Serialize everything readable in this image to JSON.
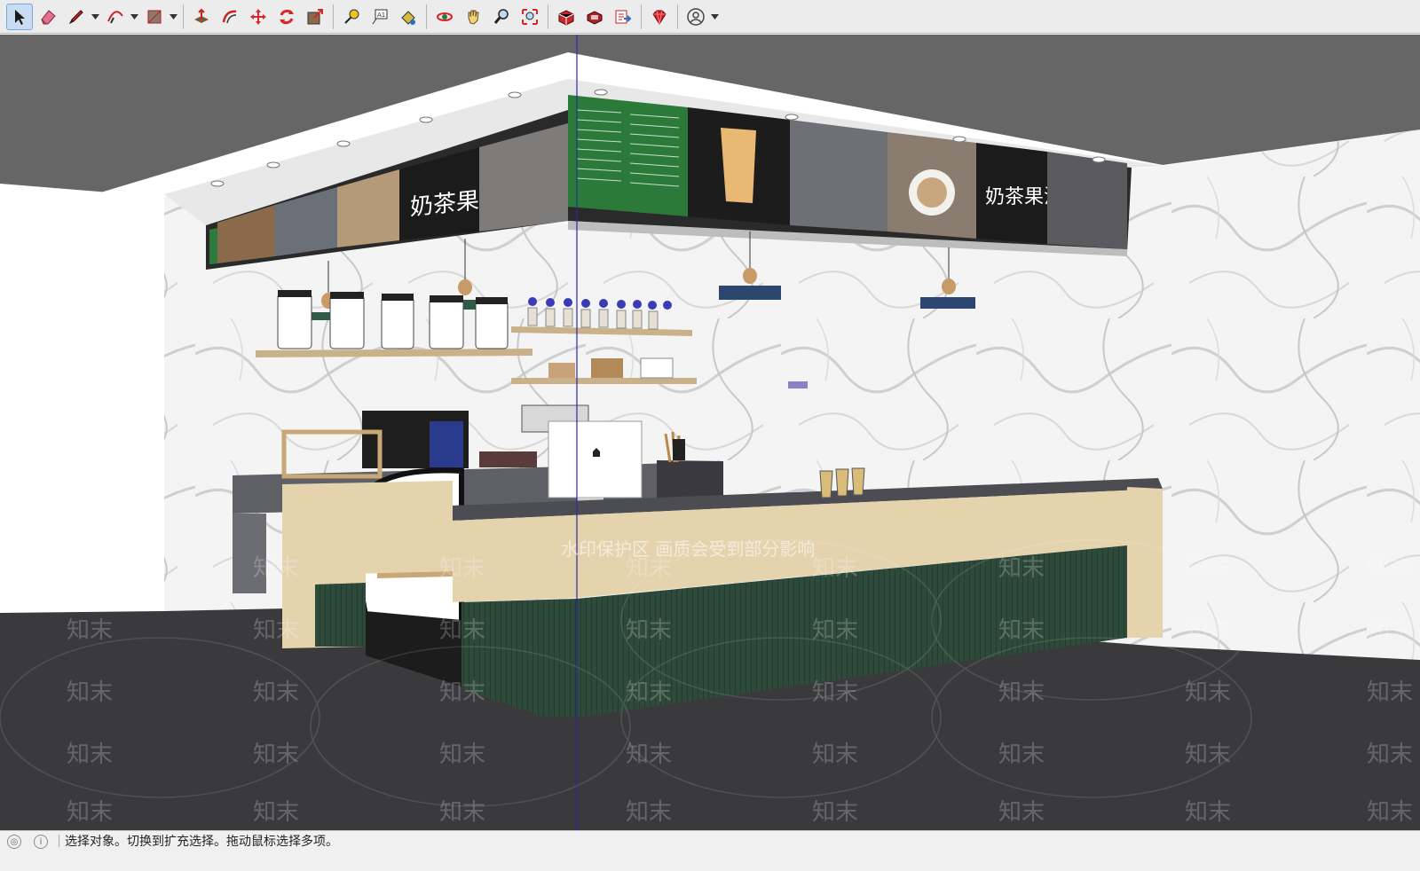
{
  "toolbar": {
    "tools": [
      {
        "name": "select-tool",
        "icon": "arrow-cursor-icon",
        "active": true
      },
      {
        "name": "eraser-tool",
        "icon": "eraser-icon"
      },
      {
        "name": "line-tool",
        "icon": "pencil-icon",
        "has_menu": true
      },
      {
        "name": "arc-tool",
        "icon": "arc-icon",
        "has_menu": true
      },
      {
        "name": "shape-tool",
        "icon": "rectangle-icon",
        "has_menu": true
      },
      {
        "name": "push-pull-tool",
        "icon": "push-pull-icon"
      },
      {
        "name": "offset-tool",
        "icon": "offset-icon"
      },
      {
        "name": "move-tool",
        "icon": "move-icon"
      },
      {
        "name": "rotate-tool",
        "icon": "rotate-icon"
      },
      {
        "name": "scale-tool",
        "icon": "scale-icon"
      },
      {
        "name": "tape-measure-tool",
        "icon": "tape-measure-icon"
      },
      {
        "name": "text-tool",
        "icon": "text-icon"
      },
      {
        "name": "paint-bucket-tool",
        "icon": "paint-bucket-icon"
      },
      {
        "name": "orbit-tool",
        "icon": "orbit-icon"
      },
      {
        "name": "pan-tool",
        "icon": "hand-icon"
      },
      {
        "name": "zoom-tool",
        "icon": "zoom-icon"
      },
      {
        "name": "zoom-extents-tool",
        "icon": "zoom-extents-icon"
      },
      {
        "name": "3d-warehouse-button",
        "icon": "warehouse-icon"
      },
      {
        "name": "extension-warehouse-button",
        "icon": "extension-icon"
      },
      {
        "name": "layout-button",
        "icon": "send-to-layout-icon"
      },
      {
        "name": "extension-manager-button",
        "icon": "ruby-gem-icon"
      },
      {
        "name": "account-button",
        "icon": "user-account-icon",
        "has_menu": true
      }
    ]
  },
  "scene": {
    "sign_text_left": "奶茶果汁",
    "sign_text_right": "奶茶果汁",
    "watermark_banner": "水印保护区   画质会受到部分影响",
    "watermark_tile": "知末"
  },
  "status": {
    "message": "选择对象。切换到扩充选择。拖动鼠标选择多项。"
  },
  "colors": {
    "accent_select": "#2a6fc4",
    "counter_green": "#2e4a3a",
    "wood": "#e5d3ae",
    "floor": "#3a3a3d",
    "ceiling": "#666666"
  }
}
